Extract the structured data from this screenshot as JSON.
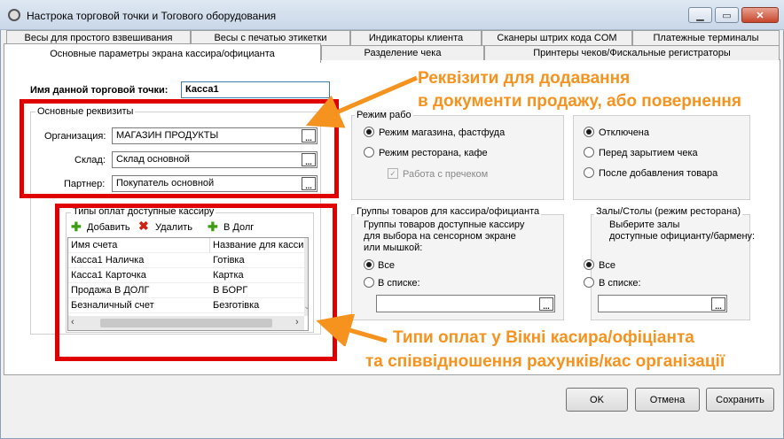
{
  "window": {
    "title": "Настрока торговой точки и Тогового оборудования",
    "minimize_icon": "minimize-icon",
    "maximize_icon": "maximize-icon",
    "close_icon": "close-icon"
  },
  "tabs_row1": [
    "Весы для простого взвешивания",
    "Весы с печатью этикетки",
    "Индикаторы клиента",
    "Сканеры штрих кода COM",
    "Платежные терминалы"
  ],
  "tabs_row2": [
    "Основные параметры экрана кассира/официанта",
    "Разделение чека",
    "Принтеры чеков/Фискальные регистраторы"
  ],
  "point_name": {
    "label": "Имя данной торговой точки:",
    "value": "Касса1"
  },
  "main_req": {
    "title": "Основные реквизиты",
    "org_label": "Организация:",
    "org_value": "МАГАЗИН ПРОДУКТЫ",
    "warehouse_label": "Склад:",
    "warehouse_value": "Склад основной",
    "partner_label": "Партнер:",
    "partner_value": "Покупатель основной",
    "dots": "..."
  },
  "work_mode": {
    "title": "Режим рабо",
    "opt1": "Режим магазина, фастфуда",
    "opt2": "Режим ресторана, кафе",
    "opt3": "Работа с пречеком"
  },
  "right_radio": {
    "opt1": "Отключена",
    "opt2": "Перед зарытием чека",
    "opt3": "После добавления товара"
  },
  "payments": {
    "title": "Типы оплат доступные кассиру",
    "add": "Добавить",
    "delete": "Удалить",
    "credit": "В Долг",
    "col1": "Имя счета",
    "col2": "Название для касси",
    "rows": [
      [
        "Касса1 Наличка",
        "Готівка"
      ],
      [
        "Касса1 Карточка",
        "Картка"
      ],
      [
        "Продажа В ДОЛГ",
        "В БОРГ"
      ],
      [
        "Безналичный счет",
        "Безготівка"
      ]
    ]
  },
  "goods_groups": {
    "title": "Группы товаров для кассира/официанта",
    "desc1": "Группы товаров доступные кассиру",
    "desc2": "для выбора на сенсорном экране",
    "desc3": "или мышкой:",
    "all": "Все",
    "in_list": "В списке:"
  },
  "halls": {
    "title": "Залы/Столы (режим ресторана)",
    "desc1": "Выберите залы",
    "desc2": "доступные официанту/бармену:",
    "all": "Все",
    "in_list": "В списке:"
  },
  "annotations": {
    "top_line1": "Реквізити для додавання",
    "top_line2": "в документи продажу, або повернення",
    "bottom_line1": "Типи оплат у Вікні касира/офіціанта",
    "bottom_line2": "та співвідношення рахунків/кас організації"
  },
  "buttons": {
    "ok": "OK",
    "cancel": "Отмена",
    "save": "Сохранить"
  },
  "colors": {
    "highlight_frame": "#e00000",
    "annotation": "#f6921e"
  }
}
